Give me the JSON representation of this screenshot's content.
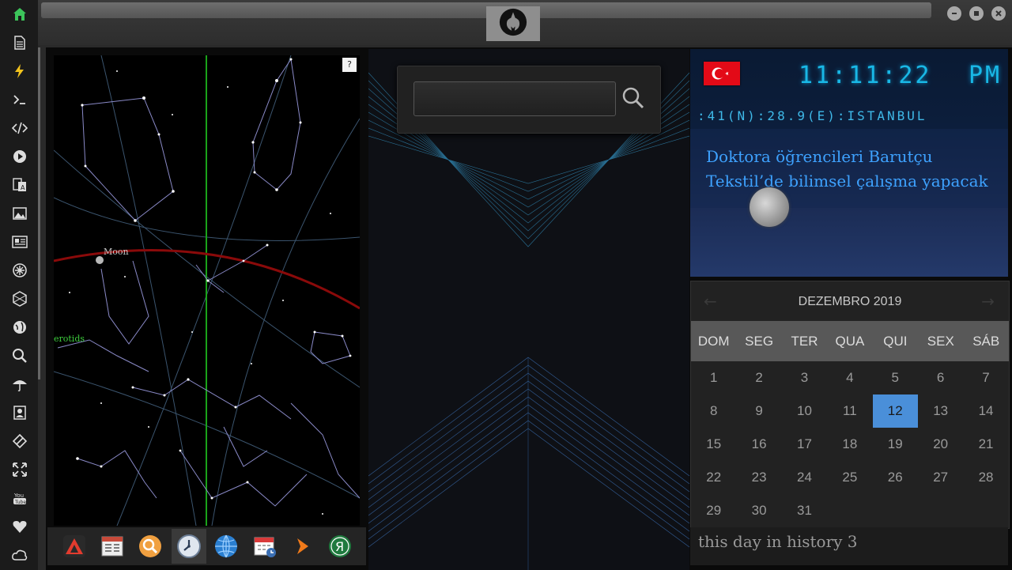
{
  "sidebar": {
    "icons": [
      "home-icon",
      "document-icon",
      "lightning-icon",
      "terminal-icon",
      "code-icon",
      "play-icon",
      "translate-icon",
      "image-icon",
      "news-icon",
      "settings-icon",
      "hexagon-icon",
      "globe-icon",
      "search-icon",
      "umbrella-icon",
      "contact-icon",
      "diamond-link-icon",
      "fullscreen-icon",
      "youtube-icon",
      "heart-icon",
      "cloud-icon"
    ]
  },
  "skymap": {
    "help_label": "?",
    "moon_label": "Moon",
    "meteor_label": "erotids"
  },
  "search": {
    "placeholder": ""
  },
  "clock": {
    "time": "11:11:22",
    "ampm": "PM",
    "coords": ":41(N):28.9(E):ISTANBUL"
  },
  "news": {
    "headline": "Doktora öğrencileri Barutçu Tekstil’de bilimsel çalışma yapacak"
  },
  "calendar": {
    "title": "DEZEMBRO 2019",
    "prev": "←",
    "next": "→",
    "weekdays": [
      "DOM",
      "SEG",
      "TER",
      "QUA",
      "QUI",
      "SEX",
      "SÁB"
    ],
    "weeks": [
      [
        "1",
        "2",
        "3",
        "4",
        "5",
        "6",
        "7"
      ],
      [
        "8",
        "9",
        "10",
        "11",
        "12",
        "13",
        "14"
      ],
      [
        "15",
        "16",
        "17",
        "18",
        "19",
        "20",
        "21"
      ],
      [
        "22",
        "23",
        "24",
        "25",
        "26",
        "27",
        "28"
      ],
      [
        "29",
        "30",
        "31",
        "",
        "",
        "",
        ""
      ]
    ],
    "selected": "12",
    "selected_color": "#4a8fd9"
  },
  "history": {
    "label": "this day in history 3"
  },
  "dock": {
    "icons": [
      "app-a-icon",
      "calendar-list-icon",
      "magnifier-icon",
      "clock-icon",
      "globe-icon",
      "calendar-icon",
      "arrow-icon",
      "ya-icon"
    ],
    "active_index": 3
  }
}
